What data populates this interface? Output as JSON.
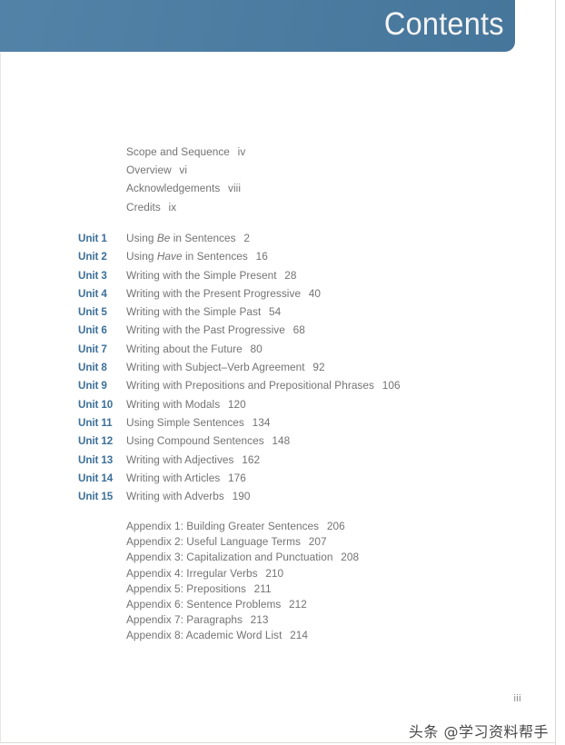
{
  "header": {
    "title": "Contents",
    "banner_color": "#4a7ca3",
    "title_color": "#ffffff"
  },
  "colors": {
    "unit_label": "#3d7099",
    "body_text": "#737373",
    "page_background": "#ffffff"
  },
  "front_matter": [
    {
      "title": "Scope and Sequence",
      "page": "iv"
    },
    {
      "title": "Overview",
      "page": "vi"
    },
    {
      "title": "Acknowledgements",
      "page": "viii"
    },
    {
      "title": "Credits",
      "page": "ix"
    }
  ],
  "units": [
    {
      "label": "Unit 1",
      "title_pre": "Using ",
      "title_em": "Be",
      "title_post": " in Sentences",
      "page": "2"
    },
    {
      "label": "Unit 2",
      "title_pre": "Using ",
      "title_em": "Have",
      "title_post": " in Sentences",
      "page": "16"
    },
    {
      "label": "Unit 3",
      "title_pre": "Writing with the Simple Present",
      "title_em": "",
      "title_post": "",
      "page": "28"
    },
    {
      "label": "Unit 4",
      "title_pre": "Writing with the Present Progressive",
      "title_em": "",
      "title_post": "",
      "page": "40"
    },
    {
      "label": "Unit 5",
      "title_pre": "Writing with the Simple Past",
      "title_em": "",
      "title_post": "",
      "page": "54"
    },
    {
      "label": "Unit 6",
      "title_pre": "Writing with the Past Progressive",
      "title_em": "",
      "title_post": "",
      "page": "68"
    },
    {
      "label": "Unit 7",
      "title_pre": "Writing about the Future",
      "title_em": "",
      "title_post": "",
      "page": "80"
    },
    {
      "label": "Unit 8",
      "title_pre": "Writing with Subject–Verb Agreement",
      "title_em": "",
      "title_post": "",
      "page": "92"
    },
    {
      "label": "Unit 9",
      "title_pre": "Writing with Prepositions and Prepositional Phrases",
      "title_em": "",
      "title_post": "",
      "page": "106"
    },
    {
      "label": "Unit 10",
      "title_pre": "Writing with Modals",
      "title_em": "",
      "title_post": "",
      "page": "120"
    },
    {
      "label": "Unit 11",
      "title_pre": "Using Simple Sentences",
      "title_em": "",
      "title_post": "",
      "page": "134"
    },
    {
      "label": "Unit 12",
      "title_pre": "Using Compound Sentences",
      "title_em": "",
      "title_post": "",
      "page": "148"
    },
    {
      "label": "Unit 13",
      "title_pre": "Writing with Adjectives",
      "title_em": "",
      "title_post": "",
      "page": "162"
    },
    {
      "label": "Unit 14",
      "title_pre": "Writing with Articles",
      "title_em": "",
      "title_post": "",
      "page": "176"
    },
    {
      "label": "Unit 15",
      "title_pre": "Writing with Adverbs",
      "title_em": "",
      "title_post": "",
      "page": "190"
    }
  ],
  "appendices": [
    {
      "title": "Appendix 1: Building Greater Sentences",
      "page": "206"
    },
    {
      "title": "Appendix 2: Useful Language Terms",
      "page": "207"
    },
    {
      "title": "Appendix 3: Capitalization and Punctuation",
      "page": "208"
    },
    {
      "title": "Appendix 4: Irregular Verbs",
      "page": "210"
    },
    {
      "title": "Appendix 5: Prepositions",
      "page": "211"
    },
    {
      "title": "Appendix 6: Sentence Problems",
      "page": "212"
    },
    {
      "title": "Appendix 7: Paragraphs",
      "page": "213"
    },
    {
      "title": "Appendix 8: Academic Word List",
      "page": "214"
    }
  ],
  "footer": {
    "folio": "iii",
    "watermark": "头条 @学习资料帮手"
  }
}
